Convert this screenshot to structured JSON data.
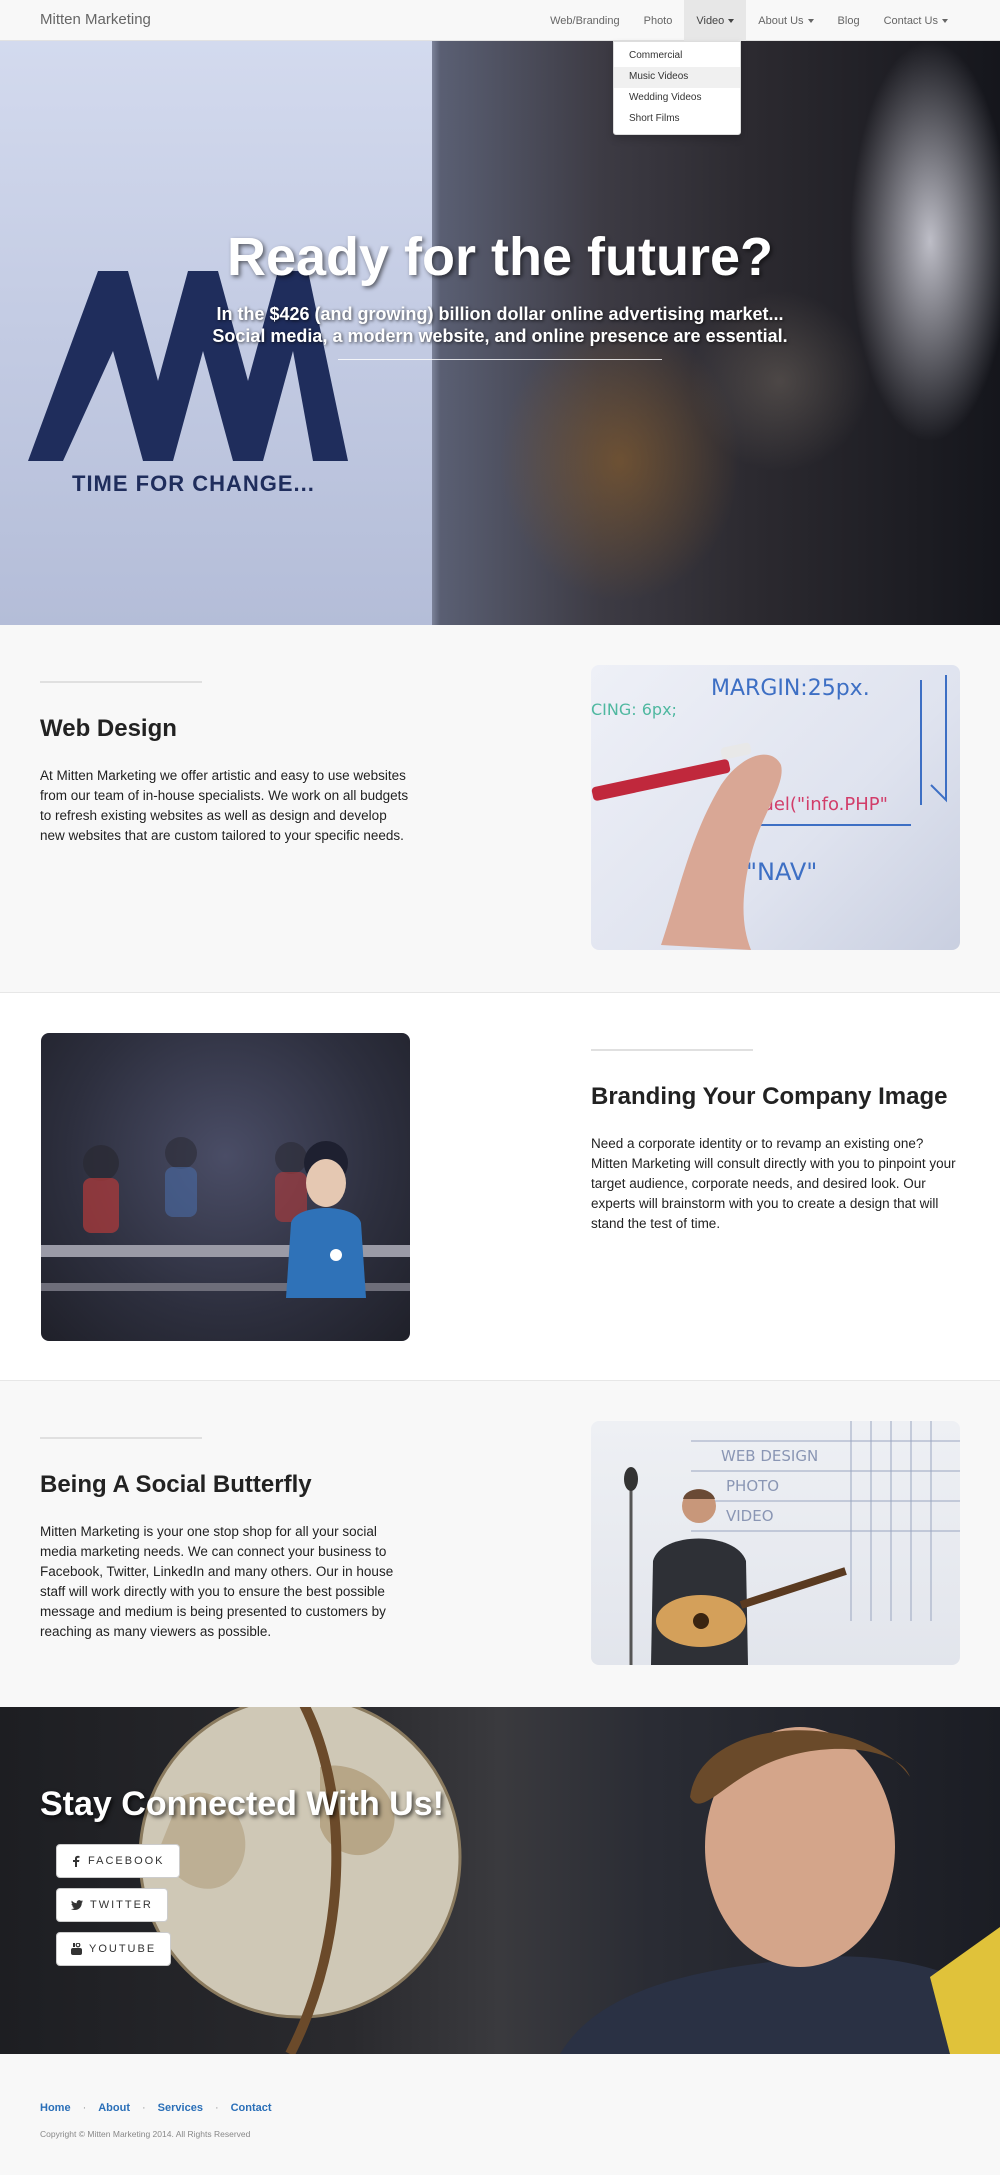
{
  "navbar": {
    "brand": "Mitten Marketing",
    "items": [
      {
        "label": "Web/Branding",
        "caret": false
      },
      {
        "label": "Photo",
        "caret": false
      },
      {
        "label": "Video",
        "caret": true
      },
      {
        "label": "About Us",
        "caret": true
      },
      {
        "label": "Blog",
        "caret": false
      },
      {
        "label": "Contact Us",
        "caret": true
      }
    ],
    "dropdown": [
      "Commercial",
      "Music Videos",
      "Wedding Videos",
      "Short Films"
    ]
  },
  "hero": {
    "title": "Ready for the future?",
    "subtitle_line1": "In the $426 (and growing) billion dollar online advertising market...",
    "subtitle_line2": "Social media, a modern website, and online presence are essential.",
    "image_tagline": "TIME FOR CHANGE..."
  },
  "sections": [
    {
      "heading": "Web Design",
      "text": "At Mitten Marketing we offer artistic and easy to use websites from our team of in-house specialists. We work on all budgets to refresh existing websites as well as design and develop new websites that are custom tailored to your specific needs.",
      "image_caption": "MARGIN:25px."
    },
    {
      "heading": "Branding Your Company Image",
      "text": "Need a corporate identity or to revamp an existing one? Mitten Marketing will consult directly with you to pinpoint your target audience, corporate needs, and desired look. Our experts will brainstorm with you to create a design that will stand the test of time."
    },
    {
      "heading": "Being A Social Butterfly",
      "text": "Mitten Marketing is your one stop shop for all your social media marketing needs. We can connect your business to Facebook, Twitter, LinkedIn and many others. Our in house staff will work directly with you to ensure the best possible message and medium is being presented to customers by reaching as many viewers as possible."
    }
  ],
  "connect": {
    "title": "Stay Connected With Us!",
    "buttons": [
      "FACEBOOK",
      "TWITTER",
      "YOUTUBE"
    ]
  },
  "footer": {
    "links": [
      "Home",
      "About",
      "Services",
      "Contact"
    ],
    "separator": "·",
    "copyright": "Copyright © Mitten Marketing 2014. All Rights Reserved"
  },
  "colors": {
    "link": "#2a6fb8",
    "navbar_bg": "#f8f8f8",
    "logo_navy": "#1f2d5c"
  }
}
